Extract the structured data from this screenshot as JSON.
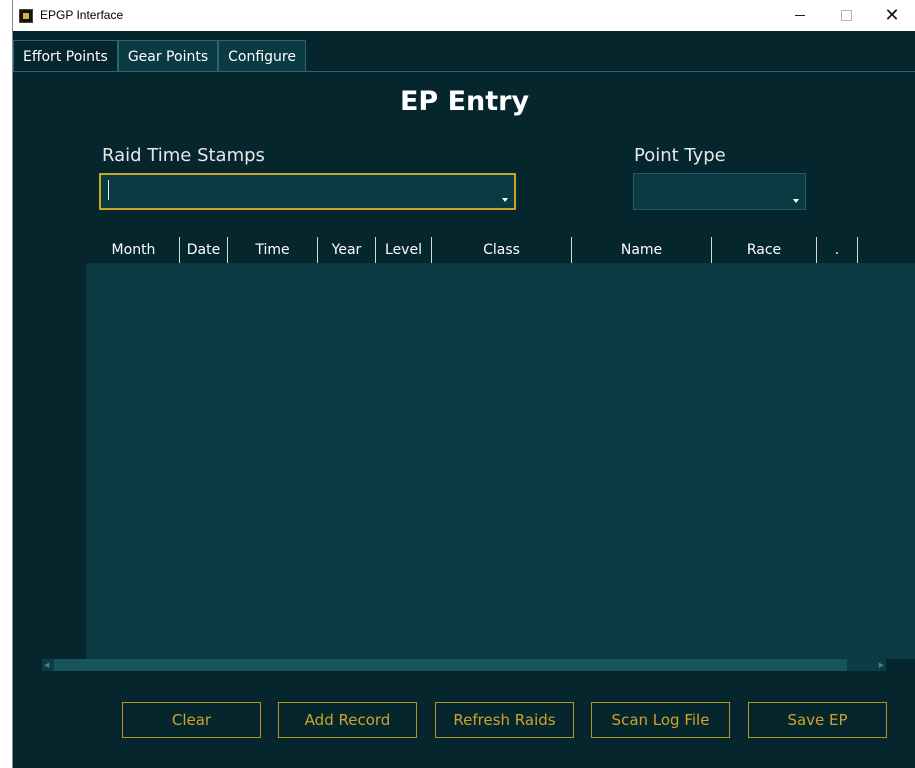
{
  "window": {
    "title": "EPGP Interface",
    "minimize": "—",
    "maximize": "",
    "close": "✕"
  },
  "tabs": [
    {
      "label": "Effort Points"
    },
    {
      "label": "Gear Points"
    },
    {
      "label": "Configure"
    }
  ],
  "main": {
    "heading": "EP Entry",
    "raid_label": "Raid Time Stamps",
    "point_label": "Point Type",
    "raid_value": "",
    "point_value": ""
  },
  "table": {
    "columns": [
      "Month",
      "Date",
      "Time",
      "Year",
      "Level",
      "Class",
      "Name",
      "Race",
      "."
    ]
  },
  "buttons": {
    "clear": "Clear",
    "add_record": "Add Record",
    "refresh_raids": "Refresh Raids",
    "scan_log_file": "Scan Log File",
    "save_ep": "Save EP"
  },
  "colors": {
    "background": "#05262d",
    "panel": "#0b3a42",
    "accent": "#c9a52b"
  }
}
